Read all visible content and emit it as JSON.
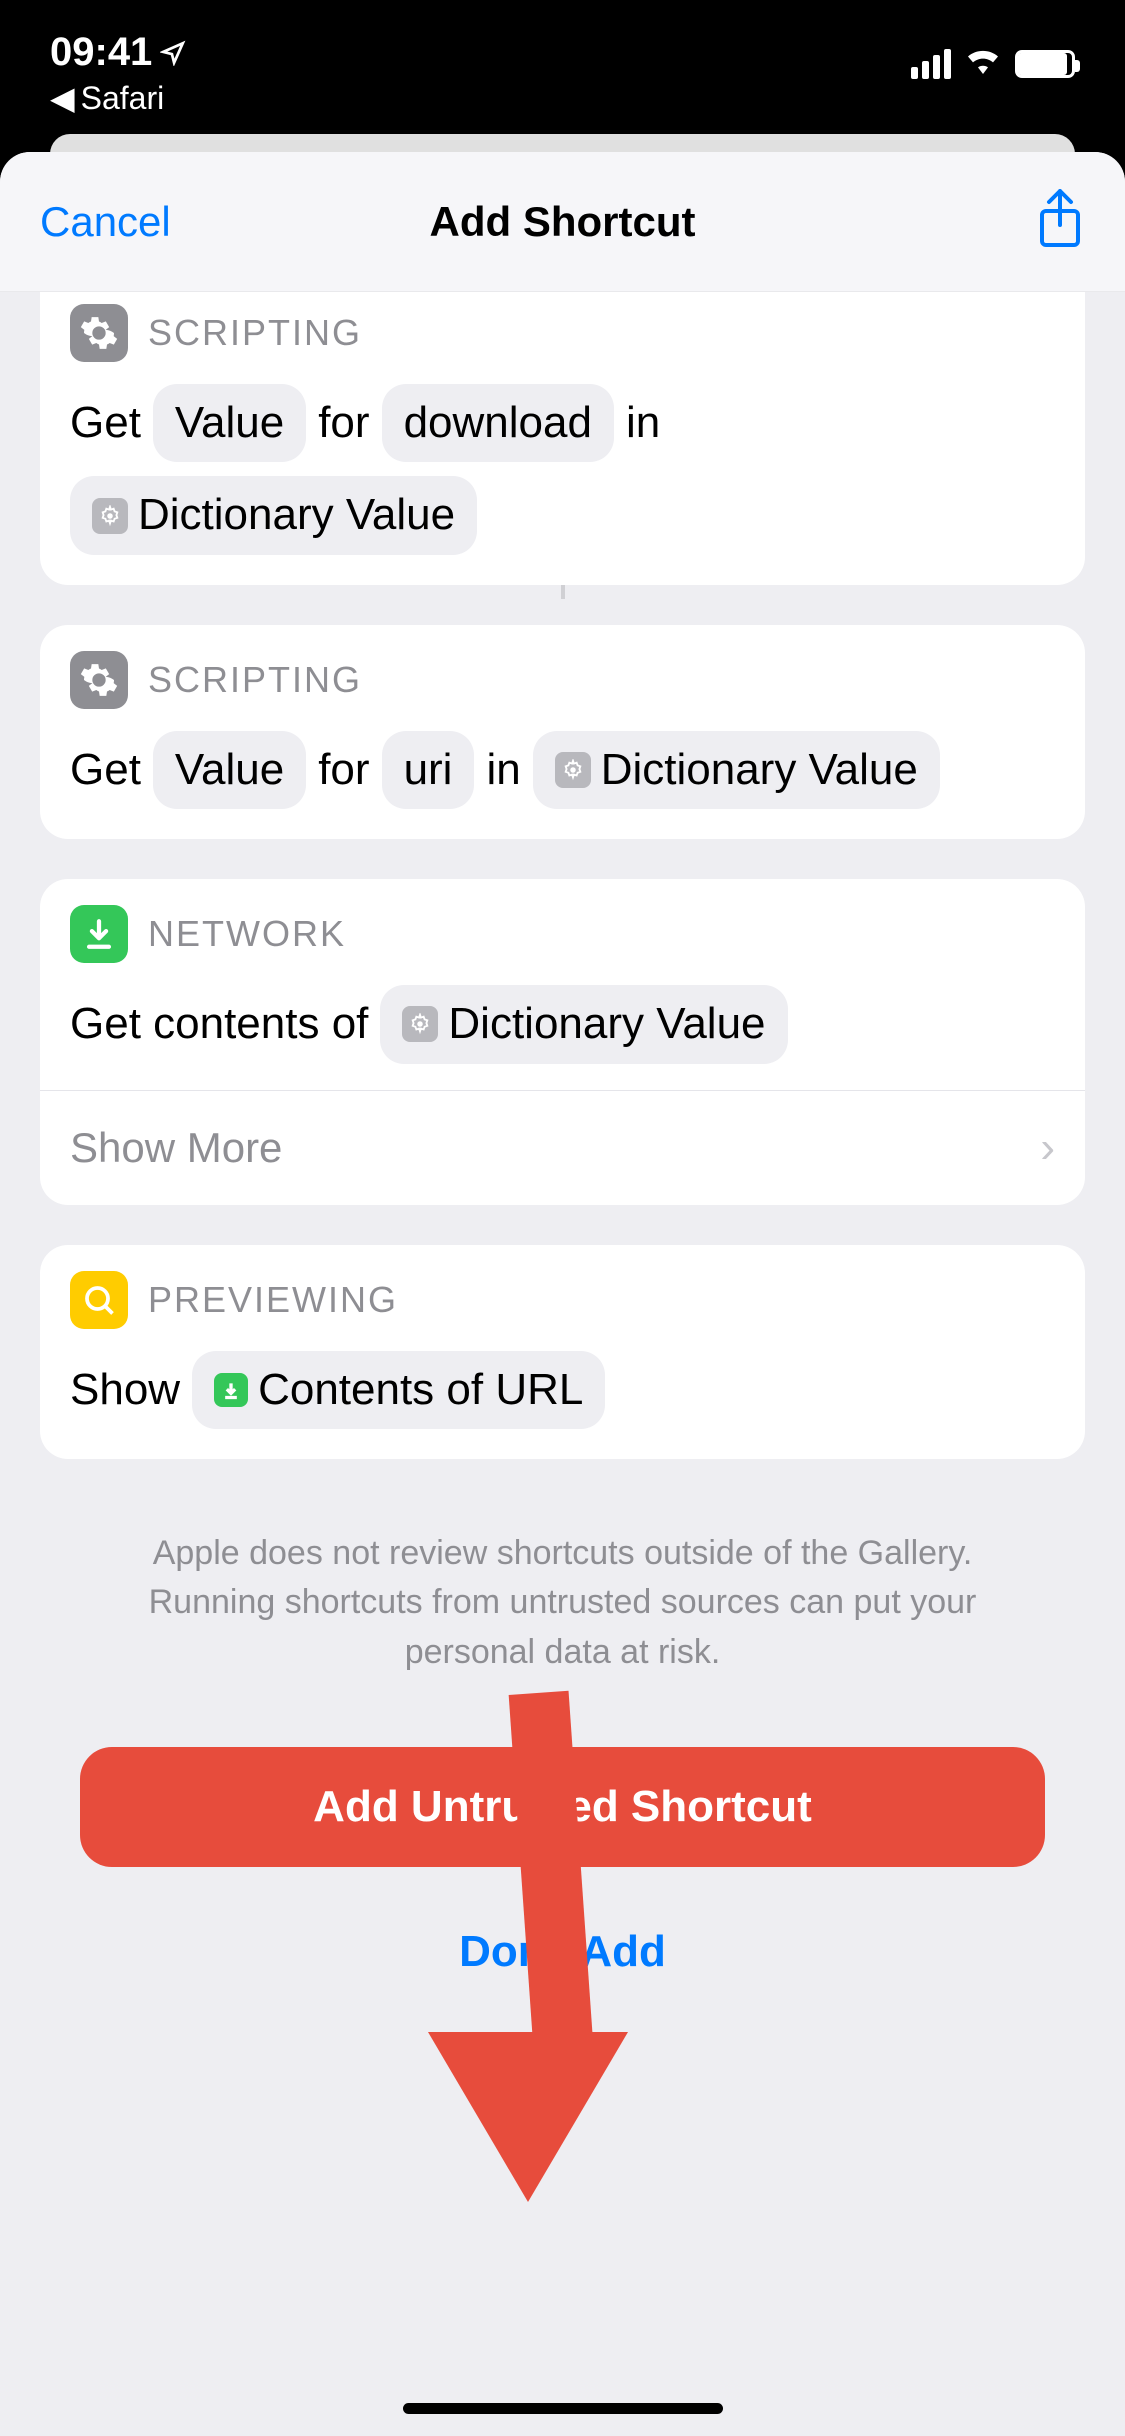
{
  "status": {
    "time": "09:41",
    "back": "Safari"
  },
  "header": {
    "cancel": "Cancel",
    "title": "Add Shortcut"
  },
  "cards": [
    {
      "category": "SCRIPTING",
      "get": "Get",
      "value": "Value",
      "for": "for",
      "key": "download",
      "in": "in",
      "dict": "Dictionary Value"
    },
    {
      "category": "SCRIPTING",
      "get": "Get",
      "value": "Value",
      "for": "for",
      "key": "uri",
      "in": "in",
      "dict": "Dictionary Value"
    },
    {
      "category": "NETWORK",
      "text": "Get contents of",
      "dict": "Dictionary Value",
      "showMore": "Show More"
    },
    {
      "category": "PREVIEWING",
      "show": "Show",
      "contents": "Contents of URL"
    }
  ],
  "disclaimer": "Apple does not review shortcuts outside of the Gallery. Running shortcuts from untrusted sources can put your personal data at risk.",
  "addButton": "Add Untrusted Shortcut",
  "dontAdd": "Don't Add"
}
